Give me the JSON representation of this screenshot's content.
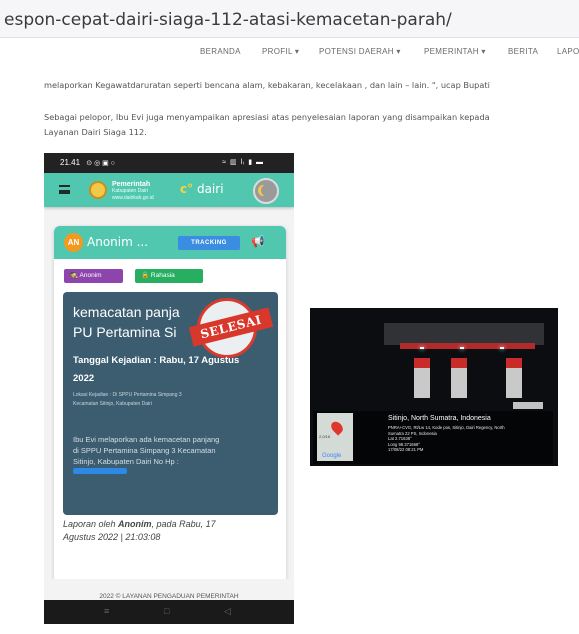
{
  "browser": {
    "url": "espon-cepat-dairi-siaga-112-atasi-kemacetan-parah/"
  },
  "nav": {
    "items": [
      "BERANDA",
      "PROFIL ▾",
      "POTENSI DAERAH ▾",
      "PEMERINTAH ▾",
      "BERITA",
      "LAPO"
    ]
  },
  "article": {
    "para1": "melaporkan Kegawatdaruratan seperti bencana alam, kebakaran, kecelakaan , dan lain – lain. \", ucap Bupati",
    "para2_line1": "Sebagai pelopor, Ibu Evi juga menyampaikan apresiasi atas penyelesaian laporan yang disampaikan kepada",
    "para2_line2": "Layanan Dairi Siaga 112."
  },
  "phone": {
    "status_time": "21.41",
    "status_left_icons": "⊙ ◎ ▣ ○",
    "status_right_icons": "≈ ▥ lᵢ ▮ ▬",
    "app_logo_line1": "Pemerintah",
    "app_logo_line2": "Kabupaten Dairi",
    "app_logo_line3": "www.dairikab.go.id",
    "app_brand": "dairi",
    "card": {
      "avatar": "AN",
      "name": "Anonim ...",
      "tracking_label": "TRACKING",
      "chip_anon": "Anonim",
      "chip_secret": "Rahasia",
      "report_title_line1": "kemacatan panja",
      "report_title_line2": "PU Pertamina Si",
      "stamp_text": "SELESAI",
      "date_line1": "Tanggal Kejadian : Rabu, 17 Agustus",
      "date_line2": "2022",
      "location_line1": "Lokasi Kejadian : Di SPPU Pertamina Simpang 3",
      "location_line2": "Kecamatan Sitinjo, Kabupaten Dairi",
      "body_line1": "Ibu Evi melaporkan ada kemacetan panjang",
      "body_line2": "di SPPU Pertamina Simpang 3 Kecamatan",
      "body_line3": "Sitinjo, Kabupaten Dairi No Hp :",
      "byline_pre": "Laporan oleh ",
      "byline_name": "Anonim",
      "byline_post": ", pada Rabu, 17",
      "byline_line2": "Agustus 2022 | 21:03:08"
    },
    "footer_text": "2022 © LAYANAN PENGADUAN PEMERINTAH",
    "navbar": [
      "≡",
      "□",
      "◁"
    ]
  },
  "photo": {
    "gps_title": "Sitinjo, North Sumatra, Indonesia",
    "gps_line1": "PNRA+CVG, Rt/Lw 14, Kode pos, Sitinjo, Dairi Regency, North",
    "gps_line2": "Sumatra 22 PS, Indonesia",
    "gps_lat": "Lat 2.71638°",
    "gps_long": "Long 98.371668°",
    "gps_time": "17/08/22 08:21 PM",
    "map_number": "2,0/16",
    "google": "Google"
  }
}
